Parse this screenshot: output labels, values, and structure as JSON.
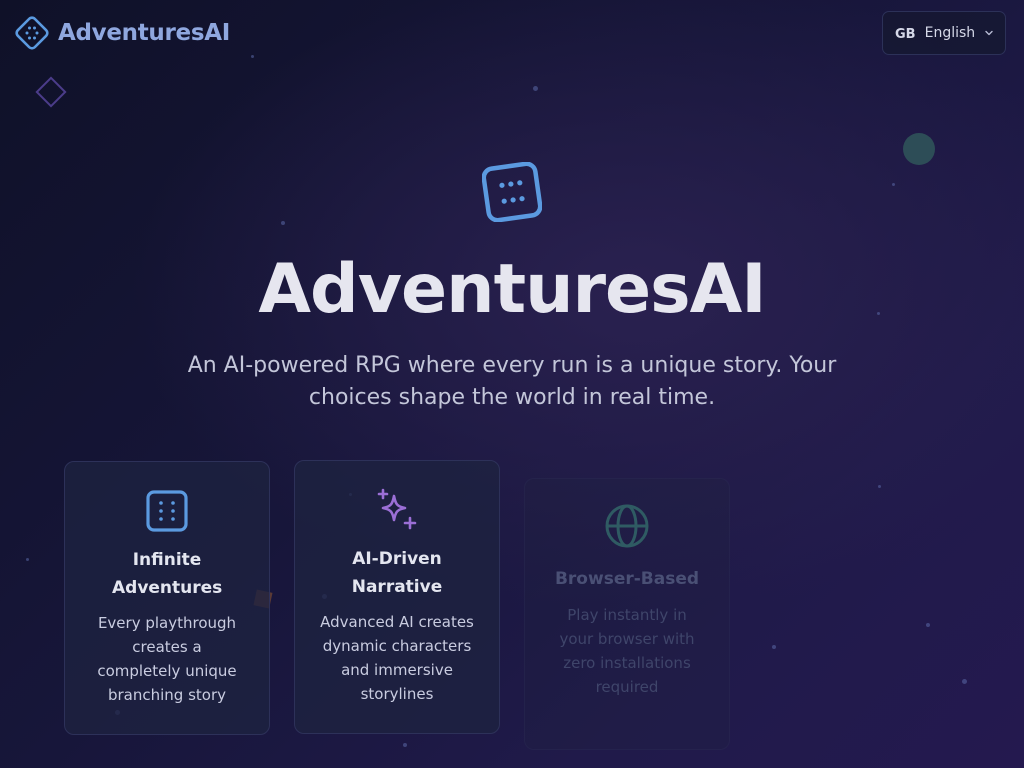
{
  "header": {
    "brand": "AdventuresAI",
    "language": {
      "code": "GB",
      "name": "English"
    }
  },
  "hero": {
    "title": "AdventuresAI",
    "subtitle": "An AI-powered RPG where every run is a unique story. Your choices shape the world in real time."
  },
  "features": [
    {
      "icon": "dice-icon",
      "title": "Infinite Adventures",
      "description": "Every playthrough creates a completely unique branching story"
    },
    {
      "icon": "sparkles-icon",
      "title": "AI-Driven Narrative",
      "description": "Advanced AI creates dynamic characters and immersive storylines"
    },
    {
      "icon": "globe-icon",
      "title": "Browser-Based",
      "description": "Play instantly in your browser with zero installations required"
    }
  ],
  "colors": {
    "brand_blue": "#5b9ae0",
    "sparkle_purple": "#9b6fd6",
    "globe_teal": "#2f5b63",
    "background": "#17163a"
  }
}
